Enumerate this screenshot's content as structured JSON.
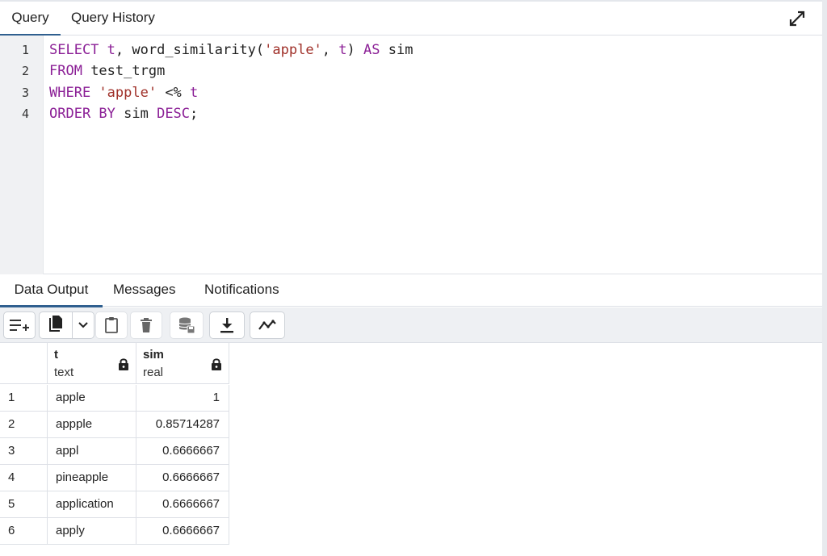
{
  "query_tabs": [
    {
      "label": "Query"
    },
    {
      "label": "Query History"
    }
  ],
  "editor": {
    "line_numbers": [
      "1",
      "2",
      "3",
      "4"
    ],
    "lines": [
      [
        {
          "t": "SELECT ",
          "c": "kw"
        },
        {
          "t": "t",
          "c": "kw"
        },
        {
          "t": ", word_similarity(",
          "c": ""
        },
        {
          "t": "'apple'",
          "c": "str"
        },
        {
          "t": ", ",
          "c": ""
        },
        {
          "t": "t",
          "c": "kw"
        },
        {
          "t": ") ",
          "c": ""
        },
        {
          "t": "AS",
          "c": "kw"
        },
        {
          "t": " sim",
          "c": ""
        }
      ],
      [
        {
          "t": "FROM",
          "c": "kw"
        },
        {
          "t": " test_trgm",
          "c": ""
        }
      ],
      [
        {
          "t": "WHERE ",
          "c": "kw"
        },
        {
          "t": "'apple'",
          "c": "str"
        },
        {
          "t": " <% ",
          "c": ""
        },
        {
          "t": "t",
          "c": "kw"
        }
      ],
      [
        {
          "t": "ORDER BY",
          "c": "kw"
        },
        {
          "t": " sim ",
          "c": ""
        },
        {
          "t": "DESC",
          "c": "kw"
        },
        {
          "t": ";",
          "c": ""
        }
      ]
    ]
  },
  "output_tabs": [
    {
      "label": "Data Output"
    },
    {
      "label": "Messages"
    },
    {
      "label": "Notifications"
    }
  ],
  "toolbar": {
    "icons": [
      "add-row-icon",
      "copy-icon",
      "chevron-down-icon",
      "paste-icon",
      "delete-icon",
      "save-data-icon",
      "download-icon",
      "graph-icon"
    ]
  },
  "grid": {
    "columns": [
      {
        "name": "t",
        "type": "text"
      },
      {
        "name": "sim",
        "type": "real"
      }
    ],
    "rows": [
      {
        "num": "1",
        "t": "apple",
        "sim": "1"
      },
      {
        "num": "2",
        "t": "appple",
        "sim": "0.85714287"
      },
      {
        "num": "3",
        "t": "appl",
        "sim": "0.6666667"
      },
      {
        "num": "4",
        "t": "pineapple",
        "sim": "0.6666667"
      },
      {
        "num": "5",
        "t": "application",
        "sim": "0.6666667"
      },
      {
        "num": "6",
        "t": "apply",
        "sim": "0.6666667"
      }
    ]
  },
  "colors": {
    "keyword": "#8b1f96",
    "string": "#a0312a",
    "active_tab_underline": "#2f5f8f"
  }
}
